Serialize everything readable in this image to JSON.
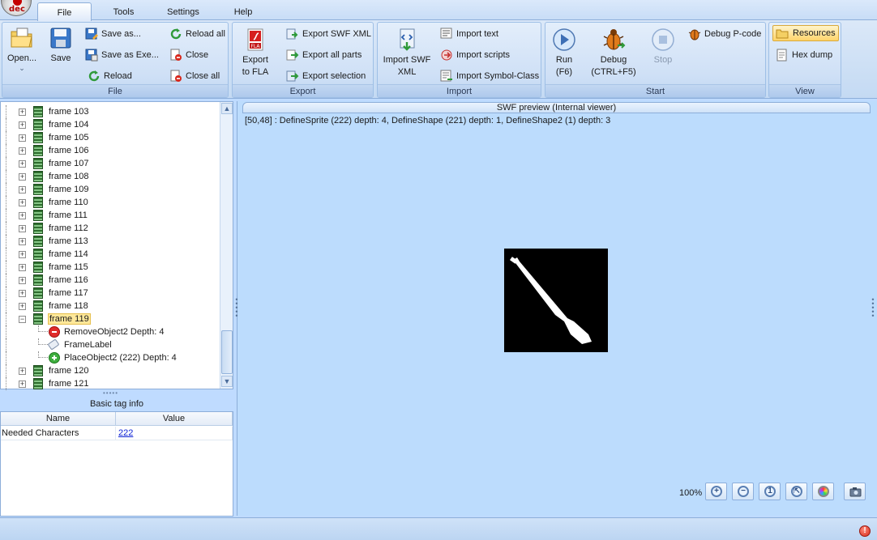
{
  "app": {
    "logo_text": "dec"
  },
  "menu_tabs": [
    {
      "label": "File",
      "active": true
    },
    {
      "label": "Tools"
    },
    {
      "label": "Settings"
    },
    {
      "label": "Help"
    }
  ],
  "ribbon": {
    "file_group": {
      "label": "File",
      "open": "Open...",
      "save": "Save",
      "save_as": "Save as...",
      "save_as_exe": "Save as Exe...",
      "reload": "Reload",
      "reload_all": "Reload all",
      "close": "Close",
      "close_all": "Close all"
    },
    "export_group": {
      "label": "Export",
      "export_fla_line1": "Export",
      "export_fla_line2": "to FLA",
      "export_fla_icon_text": "FLA",
      "export_swf_xml": "Export SWF XML",
      "export_all_parts": "Export all parts",
      "export_selection": "Export selection"
    },
    "import_group": {
      "label": "Import",
      "import_swf_xml_line1": "Import SWF",
      "import_swf_xml_line2": "XML",
      "import_text": "Import text",
      "import_scripts": "Import scripts",
      "import_symbol_class": "Import Symbol-Class"
    },
    "start_group": {
      "label": "Start",
      "run_line1": "Run",
      "run_line2": "(F6)",
      "debug_line1": "Debug",
      "debug_line2": "(CTRL+F5)",
      "stop": "Stop",
      "debug_pcode": "Debug P-code"
    },
    "view_group": {
      "label": "View",
      "resources": "Resources",
      "hex_dump": "Hex dump"
    }
  },
  "tree": {
    "frames_before": [
      "frame 103",
      "frame 104",
      "frame 105",
      "frame 106",
      "frame 107",
      "frame 108",
      "frame 109",
      "frame 110",
      "frame 111",
      "frame 112",
      "frame 113",
      "frame 114",
      "frame 115",
      "frame 116",
      "frame 117",
      "frame 118"
    ],
    "selected_frame": "frame 119",
    "selected_children": [
      "RemoveObject2 Depth: 4",
      "FrameLabel",
      "PlaceObject2 (222) Depth: 4"
    ],
    "frames_after": [
      "frame 120",
      "frame 121"
    ]
  },
  "tag_info": {
    "title": "Basic tag info",
    "col_name": "Name",
    "col_value": "Value",
    "rows": [
      {
        "name": "Needed Characters",
        "value": "222"
      }
    ]
  },
  "preview": {
    "title": "SWF preview (Internal viewer)",
    "info": "[50,48] : DefineSprite (222) depth: 4, DefineShape (221) depth: 1, DefineShape2 (1) depth: 3",
    "zoom": "100%"
  },
  "status": {
    "alert_symbol": "!"
  }
}
